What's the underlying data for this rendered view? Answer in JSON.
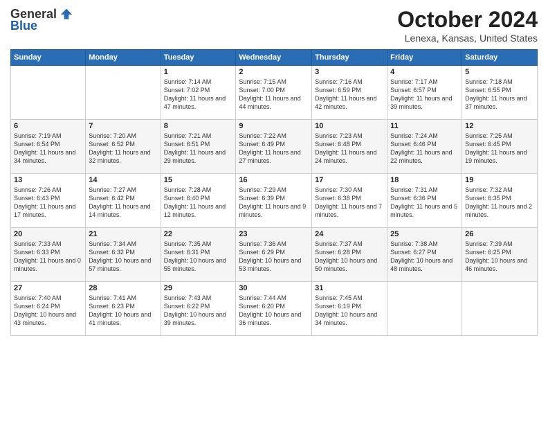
{
  "logo": {
    "general": "General",
    "blue": "Blue"
  },
  "title": "October 2024",
  "location": "Lenexa, Kansas, United States",
  "weekdays": [
    "Sunday",
    "Monday",
    "Tuesday",
    "Wednesday",
    "Thursday",
    "Friday",
    "Saturday"
  ],
  "weeks": [
    [
      {
        "day": "",
        "info": ""
      },
      {
        "day": "",
        "info": ""
      },
      {
        "day": "1",
        "info": "Sunrise: 7:14 AM\nSunset: 7:02 PM\nDaylight: 11 hours and 47 minutes."
      },
      {
        "day": "2",
        "info": "Sunrise: 7:15 AM\nSunset: 7:00 PM\nDaylight: 11 hours and 44 minutes."
      },
      {
        "day": "3",
        "info": "Sunrise: 7:16 AM\nSunset: 6:59 PM\nDaylight: 11 hours and 42 minutes."
      },
      {
        "day": "4",
        "info": "Sunrise: 7:17 AM\nSunset: 6:57 PM\nDaylight: 11 hours and 39 minutes."
      },
      {
        "day": "5",
        "info": "Sunrise: 7:18 AM\nSunset: 6:55 PM\nDaylight: 11 hours and 37 minutes."
      }
    ],
    [
      {
        "day": "6",
        "info": "Sunrise: 7:19 AM\nSunset: 6:54 PM\nDaylight: 11 hours and 34 minutes."
      },
      {
        "day": "7",
        "info": "Sunrise: 7:20 AM\nSunset: 6:52 PM\nDaylight: 11 hours and 32 minutes."
      },
      {
        "day": "8",
        "info": "Sunrise: 7:21 AM\nSunset: 6:51 PM\nDaylight: 11 hours and 29 minutes."
      },
      {
        "day": "9",
        "info": "Sunrise: 7:22 AM\nSunset: 6:49 PM\nDaylight: 11 hours and 27 minutes."
      },
      {
        "day": "10",
        "info": "Sunrise: 7:23 AM\nSunset: 6:48 PM\nDaylight: 11 hours and 24 minutes."
      },
      {
        "day": "11",
        "info": "Sunrise: 7:24 AM\nSunset: 6:46 PM\nDaylight: 11 hours and 22 minutes."
      },
      {
        "day": "12",
        "info": "Sunrise: 7:25 AM\nSunset: 6:45 PM\nDaylight: 11 hours and 19 minutes."
      }
    ],
    [
      {
        "day": "13",
        "info": "Sunrise: 7:26 AM\nSunset: 6:43 PM\nDaylight: 11 hours and 17 minutes."
      },
      {
        "day": "14",
        "info": "Sunrise: 7:27 AM\nSunset: 6:42 PM\nDaylight: 11 hours and 14 minutes."
      },
      {
        "day": "15",
        "info": "Sunrise: 7:28 AM\nSunset: 6:40 PM\nDaylight: 11 hours and 12 minutes."
      },
      {
        "day": "16",
        "info": "Sunrise: 7:29 AM\nSunset: 6:39 PM\nDaylight: 11 hours and 9 minutes."
      },
      {
        "day": "17",
        "info": "Sunrise: 7:30 AM\nSunset: 6:38 PM\nDaylight: 11 hours and 7 minutes."
      },
      {
        "day": "18",
        "info": "Sunrise: 7:31 AM\nSunset: 6:36 PM\nDaylight: 11 hours and 5 minutes."
      },
      {
        "day": "19",
        "info": "Sunrise: 7:32 AM\nSunset: 6:35 PM\nDaylight: 11 hours and 2 minutes."
      }
    ],
    [
      {
        "day": "20",
        "info": "Sunrise: 7:33 AM\nSunset: 6:33 PM\nDaylight: 11 hours and 0 minutes."
      },
      {
        "day": "21",
        "info": "Sunrise: 7:34 AM\nSunset: 6:32 PM\nDaylight: 10 hours and 57 minutes."
      },
      {
        "day": "22",
        "info": "Sunrise: 7:35 AM\nSunset: 6:31 PM\nDaylight: 10 hours and 55 minutes."
      },
      {
        "day": "23",
        "info": "Sunrise: 7:36 AM\nSunset: 6:29 PM\nDaylight: 10 hours and 53 minutes."
      },
      {
        "day": "24",
        "info": "Sunrise: 7:37 AM\nSunset: 6:28 PM\nDaylight: 10 hours and 50 minutes."
      },
      {
        "day": "25",
        "info": "Sunrise: 7:38 AM\nSunset: 6:27 PM\nDaylight: 10 hours and 48 minutes."
      },
      {
        "day": "26",
        "info": "Sunrise: 7:39 AM\nSunset: 6:25 PM\nDaylight: 10 hours and 46 minutes."
      }
    ],
    [
      {
        "day": "27",
        "info": "Sunrise: 7:40 AM\nSunset: 6:24 PM\nDaylight: 10 hours and 43 minutes."
      },
      {
        "day": "28",
        "info": "Sunrise: 7:41 AM\nSunset: 6:23 PM\nDaylight: 10 hours and 41 minutes."
      },
      {
        "day": "29",
        "info": "Sunrise: 7:43 AM\nSunset: 6:22 PM\nDaylight: 10 hours and 39 minutes."
      },
      {
        "day": "30",
        "info": "Sunrise: 7:44 AM\nSunset: 6:20 PM\nDaylight: 10 hours and 36 minutes."
      },
      {
        "day": "31",
        "info": "Sunrise: 7:45 AM\nSunset: 6:19 PM\nDaylight: 10 hours and 34 minutes."
      },
      {
        "day": "",
        "info": ""
      },
      {
        "day": "",
        "info": ""
      }
    ]
  ]
}
